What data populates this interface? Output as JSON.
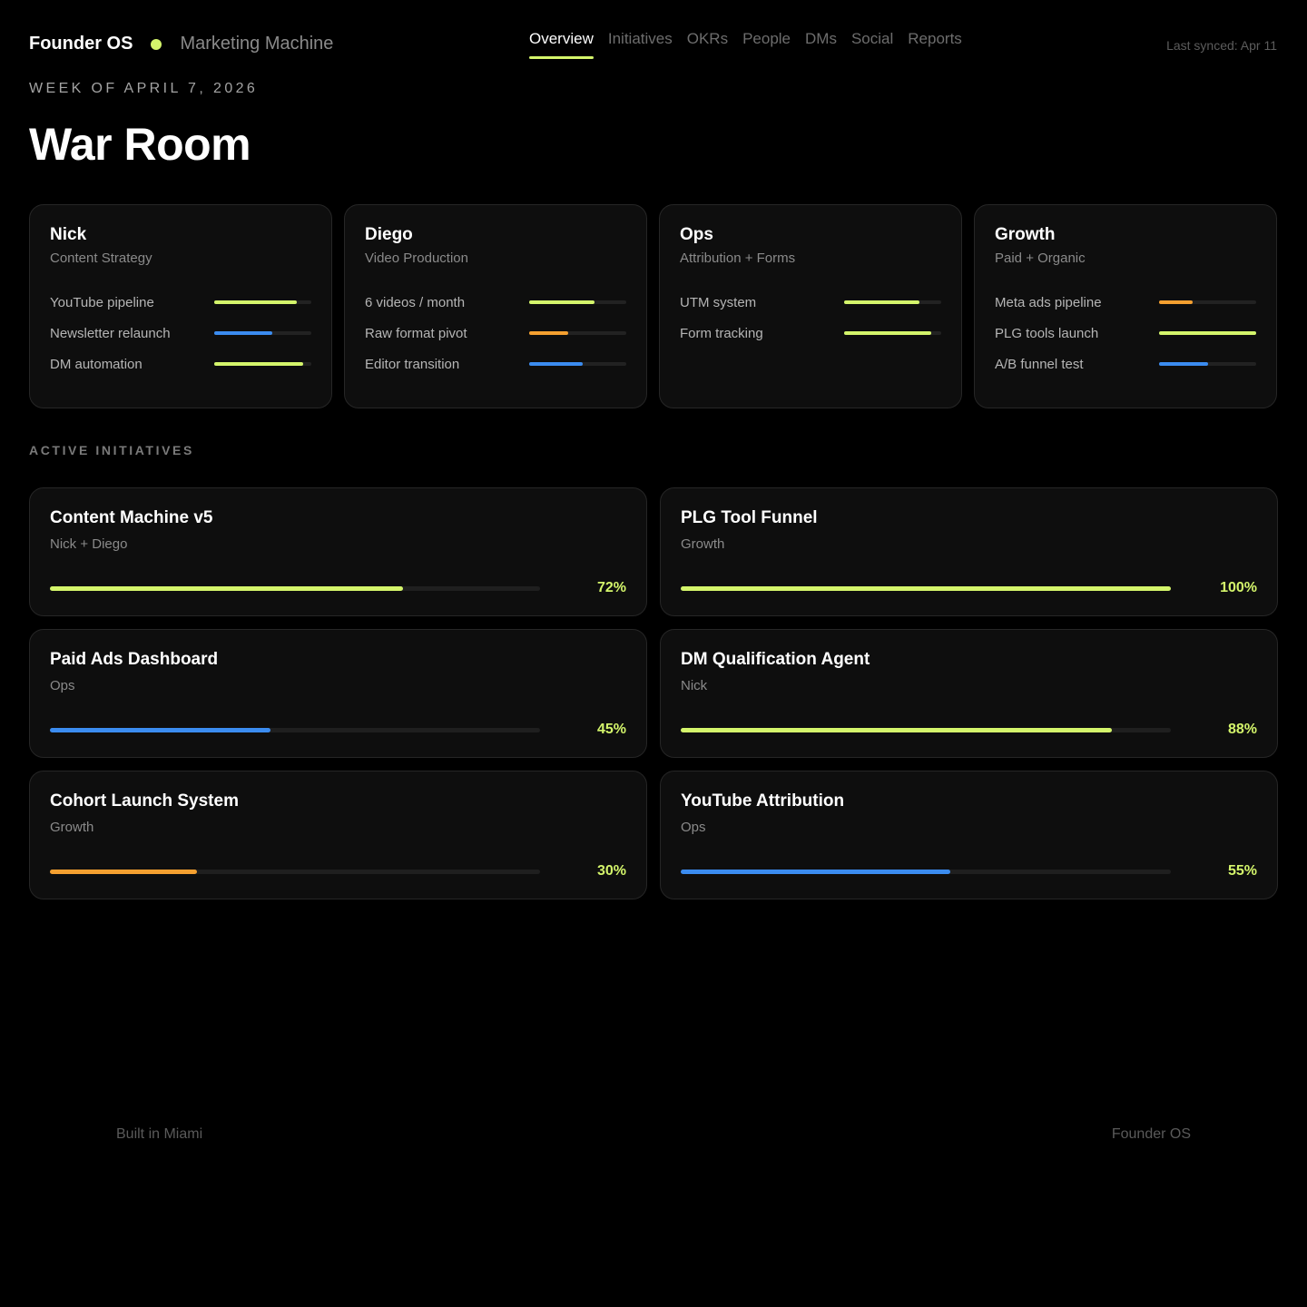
{
  "colors": {
    "accent": "#d4f56b",
    "blue": "#3b8cf0",
    "orange": "#f5a030",
    "track": "#222222"
  },
  "header": {
    "brand": "Founder OS",
    "workspace": "Marketing Machine",
    "status_dot_color": "#d4f56b",
    "tabs": [
      {
        "label": "Overview",
        "active": true
      },
      {
        "label": "Initiatives",
        "active": false
      },
      {
        "label": "OKRs",
        "active": false
      },
      {
        "label": "People",
        "active": false
      },
      {
        "label": "DMs",
        "active": false
      },
      {
        "label": "Social",
        "active": false
      },
      {
        "label": "Reports",
        "active": false
      }
    ],
    "last_synced": "Last synced: Apr 11"
  },
  "week_label": "WEEK OF APRIL 7, 2026",
  "page_title": "War Room",
  "teams": [
    {
      "name": "Nick",
      "focus": "Content Strategy",
      "items": [
        {
          "label": "YouTube pipeline",
          "progress": 0.85,
          "color": "#d4f56b"
        },
        {
          "label": "Newsletter relaunch",
          "progress": 0.6,
          "color": "#3b8cf0"
        },
        {
          "label": "DM automation",
          "progress": 0.92,
          "color": "#d4f56b"
        }
      ]
    },
    {
      "name": "Diego",
      "focus": "Video Production",
      "items": [
        {
          "label": "6 videos / month",
          "progress": 0.67,
          "color": "#d4f56b"
        },
        {
          "label": "Raw format pivot",
          "progress": 0.4,
          "color": "#f5a030"
        },
        {
          "label": "Editor transition",
          "progress": 0.55,
          "color": "#3b8cf0"
        }
      ]
    },
    {
      "name": "Ops",
      "focus": "Attribution + Forms",
      "items": [
        {
          "label": "UTM system",
          "progress": 0.78,
          "color": "#d4f56b"
        },
        {
          "label": "Form tracking",
          "progress": 0.9,
          "color": "#d4f56b"
        }
      ]
    },
    {
      "name": "Growth",
      "focus": "Paid + Organic",
      "items": [
        {
          "label": "Meta ads pipeline",
          "progress": 0.35,
          "color": "#f5a030"
        },
        {
          "label": "PLG tools launch",
          "progress": 1.0,
          "color": "#d4f56b"
        },
        {
          "label": "A/B funnel test",
          "progress": 0.5,
          "color": "#3b8cf0"
        }
      ]
    }
  ],
  "section_label": "ACTIVE INITIATIVES",
  "initiatives": [
    {
      "title": "Content Machine v5",
      "owner": "Nick + Diego",
      "progress": 0.72,
      "percent_label": "72%",
      "color": "#d4f56b"
    },
    {
      "title": "PLG Tool Funnel",
      "owner": "Growth",
      "progress": 1.0,
      "percent_label": "100%",
      "color": "#d4f56b"
    },
    {
      "title": "Paid Ads Dashboard",
      "owner": "Ops",
      "progress": 0.45,
      "percent_label": "45%",
      "color": "#3b8cf0"
    },
    {
      "title": "DM Qualification Agent",
      "owner": "Nick",
      "progress": 0.88,
      "percent_label": "88%",
      "color": "#d4f56b"
    },
    {
      "title": "Cohort Launch System",
      "owner": "Growth",
      "progress": 0.3,
      "percent_label": "30%",
      "color": "#f5a030"
    },
    {
      "title": "YouTube Attribution",
      "owner": "Ops",
      "progress": 0.55,
      "percent_label": "55%",
      "color": "#3b8cf0"
    }
  ],
  "footer": {
    "left": "Built in Miami",
    "right": "Founder OS"
  }
}
